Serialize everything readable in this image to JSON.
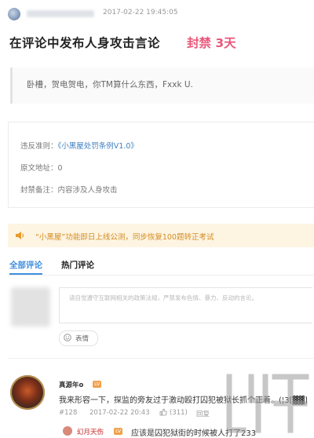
{
  "header": {
    "date": "2017-02-22 19:45:05",
    "title": "在评论中发布人身攻击言论",
    "ban_label": "封禁 3天"
  },
  "quote": {
    "text": "卧槽，贺电贺电，你TM算什么东西，Fxxk U."
  },
  "rule_box": {
    "rule_label": "违反准则：",
    "rule_link": "《小黑屋处罚条例V1.0》",
    "origin_label": "原文地址：0",
    "note_label": "封禁备注：内容涉及人身攻击"
  },
  "banner": {
    "text": "“小黑屋”功能即日上线公测，同步恢复100题转正考试",
    "color": "#d38c22"
  },
  "tabs": {
    "all": "全部评论",
    "hot": "热门评论"
  },
  "composer": {
    "placeholder": "请自觉遵守互联网相关的政策法规，严禁发布色情、暴力、反动的言论。",
    "emoji_label": "表情"
  },
  "comments": [
    {
      "name": "真源年o",
      "badge": "LV",
      "text": "我来形容一下，探监的旁友过于激动殴打囚犯被狱长抓个正着。(¦3[▓▓]",
      "floor": "#128",
      "time": "2017-02-22 20:43",
      "likes": "(311)",
      "reply": "回复"
    }
  ],
  "reply": {
    "name": "幻月天伤",
    "badge": "LV",
    "text": "应该是囚犯狱街的时候被人打了233"
  },
  "colors": {
    "accent_blue": "#3f8ede",
    "ban_pink": "#e8577a",
    "banner_bg": "#fdf4e2"
  }
}
